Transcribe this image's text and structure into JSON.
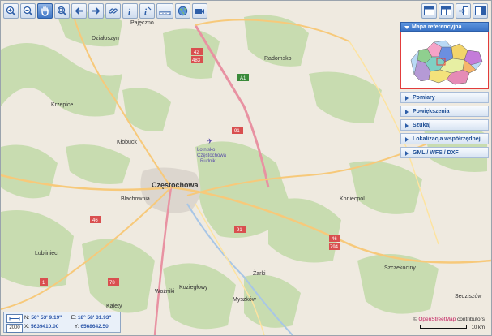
{
  "toolbar": {
    "buttons": [
      "zoom-in",
      "zoom-out",
      "pan",
      "zoom-box",
      "back",
      "forward",
      "link",
      "info",
      "identify",
      "measure",
      "globe",
      "video"
    ]
  },
  "panel": {
    "header": "Mapa referencyjna",
    "items": [
      "Pomiary",
      "Powiększenia",
      "Szukaj",
      "Lokalizacja współrzędnej",
      "GML / WFS / DXF"
    ]
  },
  "coords": {
    "scale": "2000",
    "n_label": "N:",
    "n_value": "50° 53' 9.19\"",
    "e_label": "E:",
    "e_value": "18° 58' 31.93\"",
    "x_label": "X:",
    "x_value": "5639410.00",
    "y_label": "Y:",
    "y_value": "6568642.50"
  },
  "attribution": {
    "prefix": "©",
    "link": "OpenStreetMap",
    "suffix": "contributors"
  },
  "scalebar": {
    "label": "10 km"
  },
  "map_labels": {
    "pajeczno": "Pajęczno",
    "dzialoszyn": "Działoszyn",
    "radomsko": "Radomsko",
    "krzepice": "Krzepice",
    "klobuck": "Kłobuck",
    "czestochowa": "Częstochowa",
    "lotnisko": "Lotnisko",
    "lotnisko2": "Częstochowa",
    "lotnisko3": "Rudniki",
    "blachownia": "Blachownia",
    "lubliniec": "Lubliniec",
    "koniecpol": "Koniecpol",
    "szczekociny": "Szczekociny",
    "zarki": "Żarki",
    "myszkow": "Myszków",
    "koziegłowy": "Koziegłowy",
    "wozniki": "Woźniki",
    "kalety": "Kalety",
    "sedziszow": "Sędziszów",
    "r42": "42",
    "r483": "483",
    "r91a": "91",
    "r91b": "91",
    "rA1": "A1",
    "r46a": "46",
    "r46b": "46",
    "r794": "794",
    "r1": "1",
    "r78": "78"
  },
  "colors": {
    "accent": "#3a73c6",
    "forest": "#c8dcb0",
    "background": "#efeae0",
    "road_major": "#e892a2",
    "road_secondary": "#f7c97a"
  }
}
